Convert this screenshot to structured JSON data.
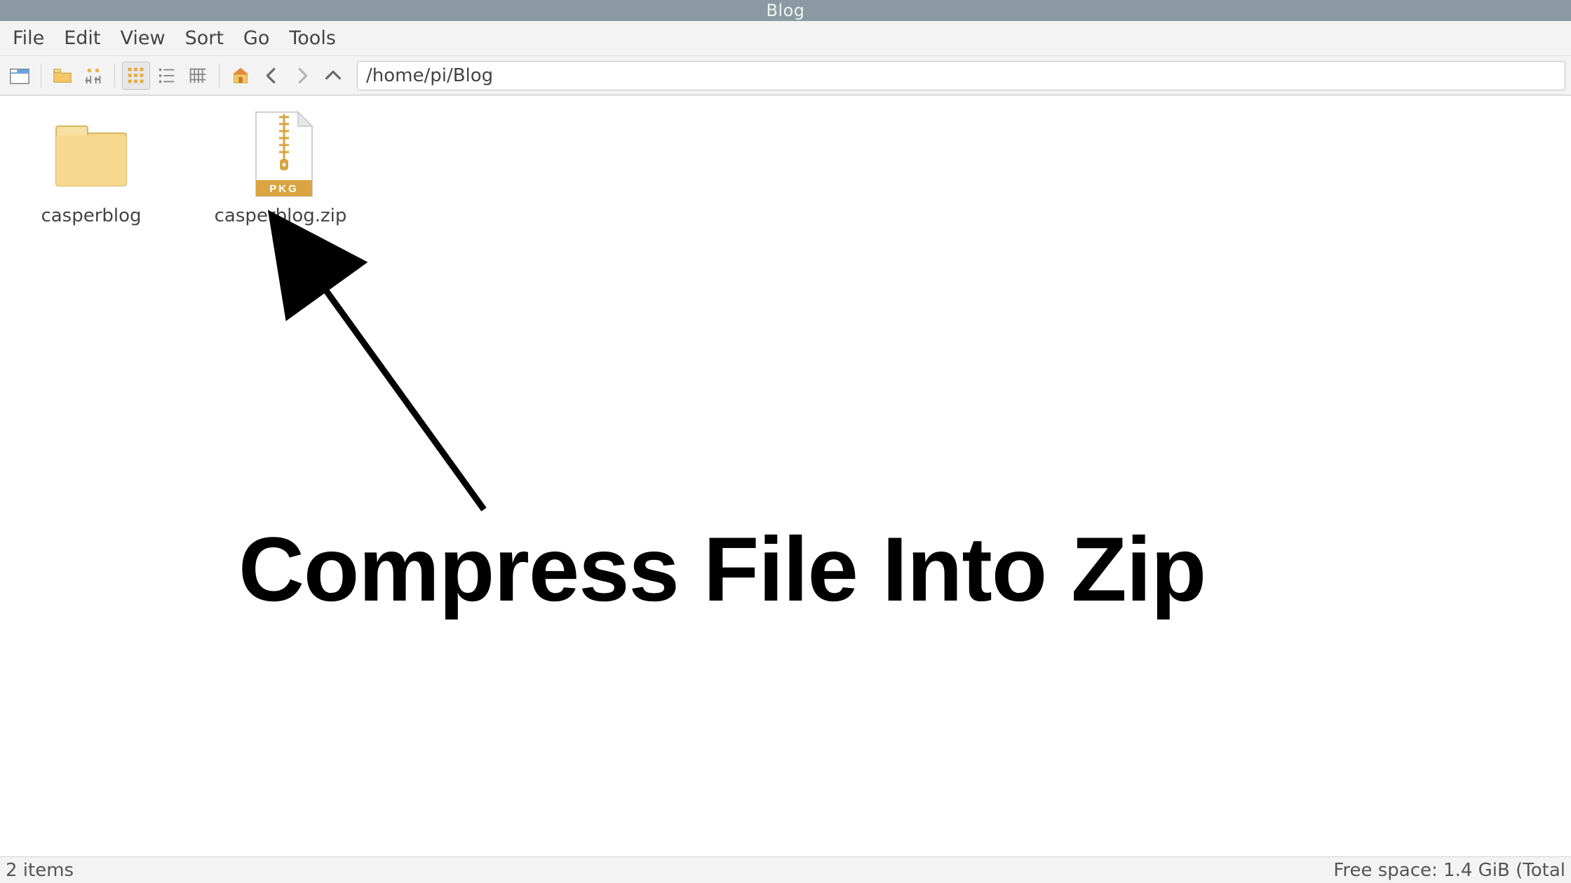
{
  "titlebar": {
    "title": "Blog"
  },
  "menubar": {
    "items": [
      "File",
      "Edit",
      "View",
      "Sort",
      "Go",
      "Tools"
    ]
  },
  "toolbar": {
    "path": "/home/pi/Blog"
  },
  "files": [
    {
      "name": "casperblog",
      "type": "folder"
    },
    {
      "name": "casperblog.zip",
      "type": "archive",
      "badge": "PKG"
    }
  ],
  "annotation": {
    "text": "Compress File Into Zip"
  },
  "statusbar": {
    "left": "2 items",
    "right": "Free space: 1.4 GiB (Total"
  }
}
